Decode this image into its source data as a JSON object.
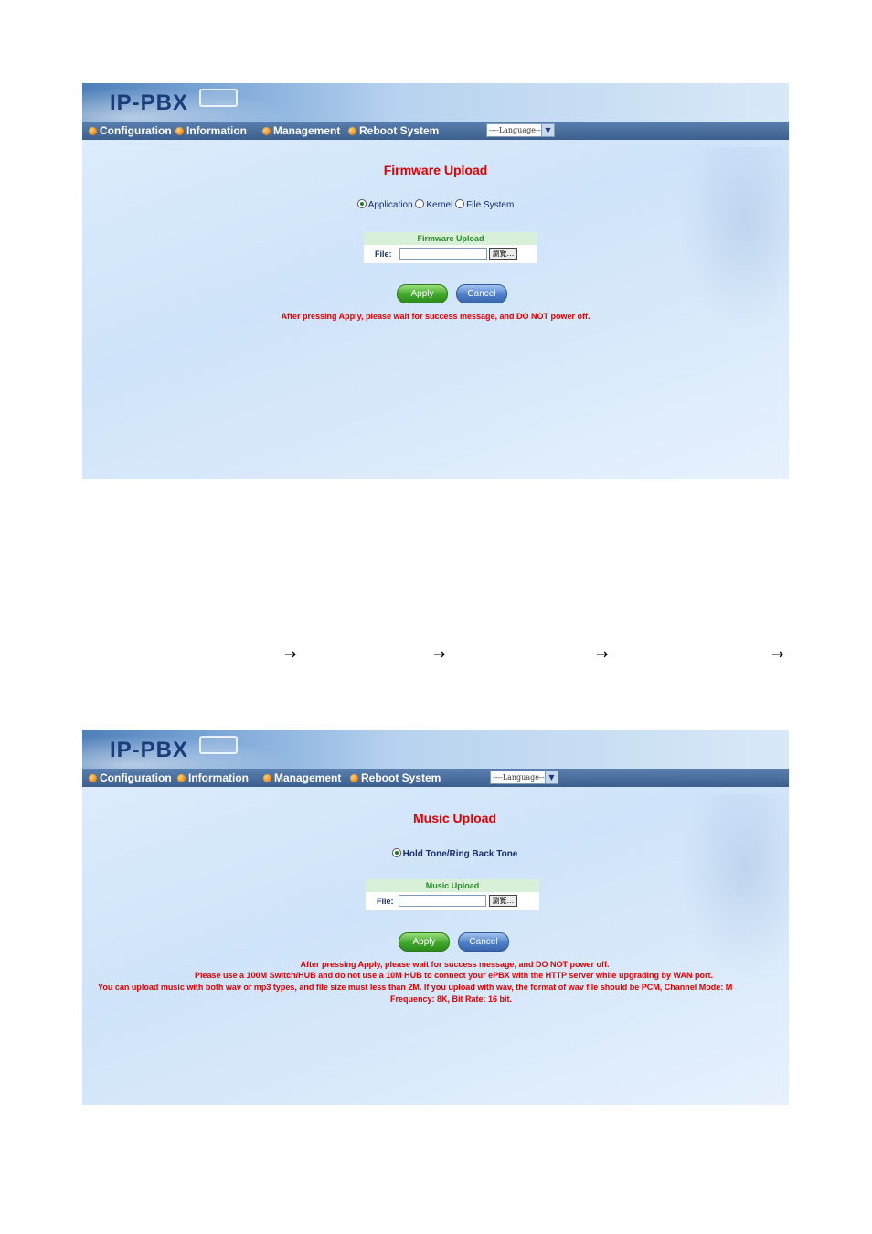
{
  "screens": [
    {
      "logo": "IP-PBX",
      "nav": [
        "Configuration",
        "Information",
        "Management",
        "Reboot System"
      ],
      "language_select": "----Language----",
      "title": "Firmware Upload",
      "radio_options": [
        "Application",
        "Kernel",
        "File System"
      ],
      "radio_selected": "Application",
      "upload_header": "Firmware Upload",
      "file_label": "File:",
      "browse_label": "瀏覽...",
      "apply_label": "Apply",
      "cancel_label": "Cancel",
      "messages": [
        "After pressing Apply, please wait for success message, and DO NOT power off."
      ]
    },
    {
      "logo": "IP-PBX",
      "nav": [
        "Configuration",
        "Information",
        "Management",
        "Reboot System"
      ],
      "language_select": "----Language----",
      "title": "Music Upload",
      "radio_options": [
        "Hold Tone/Ring Back Tone"
      ],
      "radio_selected": "Hold Tone/Ring Back Tone",
      "upload_header": "Music Upload",
      "file_label": "File:",
      "browse_label": "瀏覽...",
      "apply_label": "Apply",
      "cancel_label": "Cancel",
      "messages": [
        "After pressing Apply, please wait for success message, and DO NOT power off.",
        "Please use a 100M Switch/HUB and do not use a 10M HUB to connect your ePBX with the HTTP server while upgrading by WAN port.",
        "You can upload music with both wav or mp3 types, and file size must less than 2M. If you upload with wav, the format of wav file should be PCM, Channel Mode: M",
        "Frequency: 8K, Bit Rate: 16 bit."
      ]
    }
  ],
  "arrows": [
    "→",
    "→",
    "→",
    "→"
  ]
}
